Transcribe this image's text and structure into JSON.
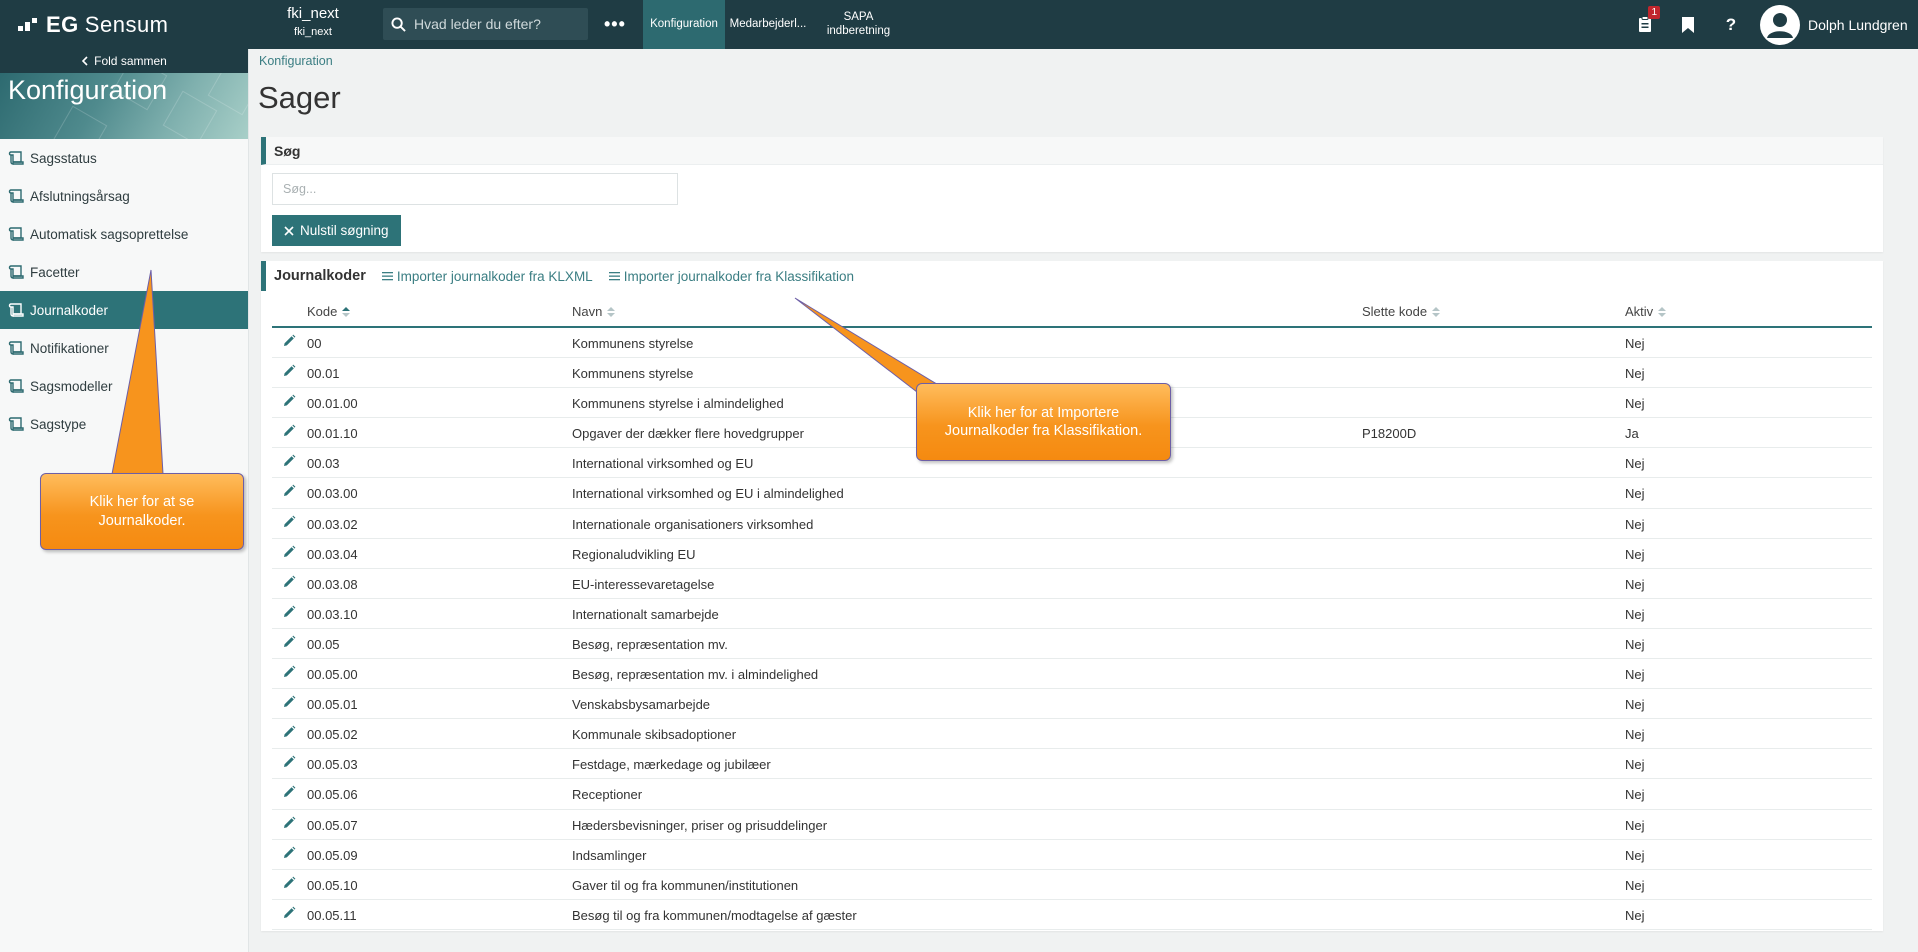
{
  "brand": {
    "prefix": "EG",
    "name": "Sensum"
  },
  "tenant": {
    "name": "fki_next",
    "sub": "fki_next"
  },
  "search": {
    "placeholder": "Hvad leder du efter?"
  },
  "more_label": "•••",
  "nav_tabs": [
    {
      "line1": "Konfiguration",
      "line2": ""
    },
    {
      "line1": "Medarbejderl...",
      "line2": ""
    },
    {
      "line1": "SAPA",
      "line2": "indberetning"
    }
  ],
  "notifications": {
    "count": "1"
  },
  "help_label": "?",
  "user": {
    "name": "Dolph Lundgren"
  },
  "sidebar": {
    "fold_label": "Fold sammen",
    "title": "Konfiguration",
    "items": [
      {
        "label": "Sagsstatus"
      },
      {
        "label": "Afslutningsårsag"
      },
      {
        "label": "Automatisk sagsoprettelse"
      },
      {
        "label": "Facetter"
      },
      {
        "label": "Journalkoder"
      },
      {
        "label": "Notifikationer"
      },
      {
        "label": "Sagsmodeller"
      },
      {
        "label": "Sagstype"
      }
    ],
    "active_index": 4
  },
  "breadcrumb": "Konfiguration",
  "page_title": "Sager",
  "search_panel": {
    "title": "Søg",
    "input_placeholder": "Søg...",
    "reset_label": "Nulstil søgning"
  },
  "journal": {
    "title": "Journalkoder",
    "import_klxml": "Importer journalkoder fra KLXML",
    "import_klass": "Importer journalkoder fra Klassifikation",
    "columns": {
      "kode": "Kode",
      "navn": "Navn",
      "slette": "Slette kode",
      "aktiv": "Aktiv"
    },
    "rows": [
      {
        "kode": "00",
        "navn": "Kommunens styrelse",
        "slette": "",
        "aktiv": "Nej"
      },
      {
        "kode": "00.01",
        "navn": "Kommunens styrelse",
        "slette": "",
        "aktiv": "Nej"
      },
      {
        "kode": "00.01.00",
        "navn": "Kommunens styrelse i almindelighed",
        "slette": "",
        "aktiv": "Nej"
      },
      {
        "kode": "00.01.10",
        "navn": "Opgaver der dækker flere hovedgrupper",
        "slette": "P18200D",
        "aktiv": "Ja"
      },
      {
        "kode": "00.03",
        "navn": "International virksomhed og EU",
        "slette": "",
        "aktiv": "Nej"
      },
      {
        "kode": "00.03.00",
        "navn": "International virksomhed og EU i almindelighed",
        "slette": "",
        "aktiv": "Nej"
      },
      {
        "kode": "00.03.02",
        "navn": "Internationale organisationers virksomhed",
        "slette": "",
        "aktiv": "Nej"
      },
      {
        "kode": "00.03.04",
        "navn": "Regionaludvikling EU",
        "slette": "",
        "aktiv": "Nej"
      },
      {
        "kode": "00.03.08",
        "navn": "EU-interessevaretagelse",
        "slette": "",
        "aktiv": "Nej"
      },
      {
        "kode": "00.03.10",
        "navn": "Internationalt samarbejde",
        "slette": "",
        "aktiv": "Nej"
      },
      {
        "kode": "00.05",
        "navn": "Besøg, repræsentation mv.",
        "slette": "",
        "aktiv": "Nej"
      },
      {
        "kode": "00.05.00",
        "navn": "Besøg, repræsentation mv. i almindelighed",
        "slette": "",
        "aktiv": "Nej"
      },
      {
        "kode": "00.05.01",
        "navn": "Venskabsbysamarbejde",
        "slette": "",
        "aktiv": "Nej"
      },
      {
        "kode": "00.05.02",
        "navn": "Kommunale skibsadoptioner",
        "slette": "",
        "aktiv": "Nej"
      },
      {
        "kode": "00.05.03",
        "navn": "Festdage, mærkedage og jubilæer",
        "slette": "",
        "aktiv": "Nej"
      },
      {
        "kode": "00.05.06",
        "navn": "Receptioner",
        "slette": "",
        "aktiv": "Nej"
      },
      {
        "kode": "00.05.07",
        "navn": "Hædersbevisninger, priser og prisuddelinger",
        "slette": "",
        "aktiv": "Nej"
      },
      {
        "kode": "00.05.09",
        "navn": "Indsamlinger",
        "slette": "",
        "aktiv": "Nej"
      },
      {
        "kode": "00.05.10",
        "navn": "Gaver til og fra kommunen/institutionen",
        "slette": "",
        "aktiv": "Nej"
      },
      {
        "kode": "00.05.11",
        "navn": "Besøg til og fra kommunen/modtagelse af gæster",
        "slette": "",
        "aktiv": "Nej"
      }
    ]
  },
  "callouts": {
    "left": "Klik her for at se Journalkoder.",
    "right": "Klik her for at Importere Journalkoder fra Klassifikation."
  },
  "colors": {
    "topbar": "#1f3c44",
    "accent": "#2d7378",
    "link": "#3b7e83",
    "callout": "#f7941d",
    "badge": "#c0262d"
  }
}
